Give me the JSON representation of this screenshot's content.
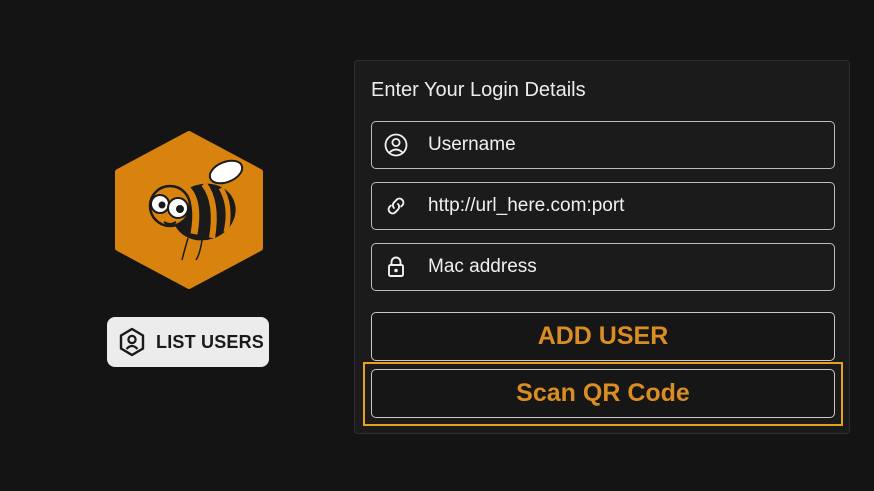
{
  "login": {
    "title": "Enter Your Login Details",
    "username": {
      "icon": "user-circle-icon",
      "value": "Username"
    },
    "url": {
      "icon": "link-icon",
      "value": "http://url_here.com:port"
    },
    "mac": {
      "icon": "lock-icon",
      "value": "Mac address"
    },
    "add_user_label": "ADD USER",
    "scan_qr_label": "Scan QR Code"
  },
  "sidebar": {
    "logo_icon": "bee-logo-icon",
    "list_users_icon": "user-hexagon-icon",
    "list_users_label": "LIST USERS"
  },
  "colors": {
    "background": "#141414",
    "accent": "#d98d22",
    "focus_outline": "#e6a21c",
    "logo_orange": "#d9830f"
  }
}
